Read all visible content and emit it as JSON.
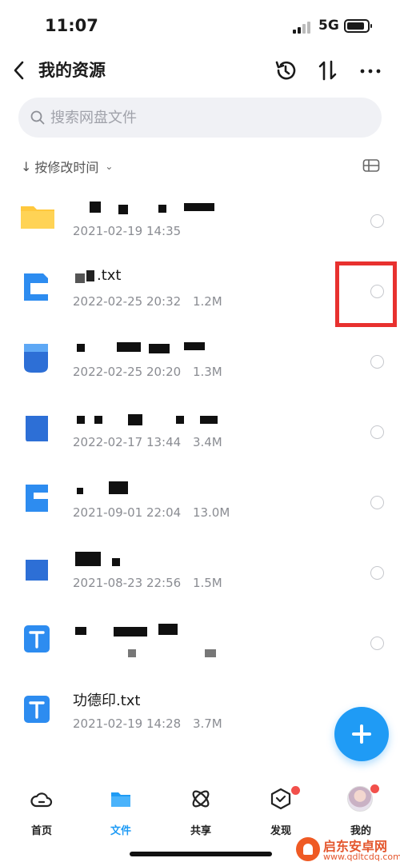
{
  "status_bar": {
    "time": "11:07",
    "network": "5G"
  },
  "header": {
    "title": "我的资源"
  },
  "search": {
    "placeholder": "搜索网盘文件"
  },
  "sort": {
    "label": "按修改时间"
  },
  "files": [
    {
      "name": "",
      "date": "2021-02-19 14:35",
      "size": "",
      "icon": "folder-icon"
    },
    {
      "name": ".txt",
      "date": "2022-02-25 20:32",
      "size": "1.2M",
      "icon": "document-icon"
    },
    {
      "name": "",
      "date": "2022-02-25 20:20",
      "size": "1.3M",
      "icon": "document-icon"
    },
    {
      "name": "",
      "date": "2022-02-17 13:44",
      "size": "3.4M",
      "icon": "document-icon"
    },
    {
      "name": "",
      "date": "2021-09-01 22:04",
      "size": "13.0M",
      "icon": "document-icon"
    },
    {
      "name": "",
      "date": "2021-08-23 22:56",
      "size": "1.5M",
      "icon": "document-icon"
    },
    {
      "name": "",
      "date": "",
      "size": "",
      "icon": "text-file-icon"
    },
    {
      "name": "功德印.txt",
      "date": "2021-02-19 14:28",
      "size": "3.7M",
      "icon": "text-file-icon"
    }
  ],
  "tabs": [
    {
      "label": "首页",
      "icon": "cloud-home-icon"
    },
    {
      "label": "文件",
      "icon": "folder-icon"
    },
    {
      "label": "共享",
      "icon": "atom-share-icon"
    },
    {
      "label": "发现",
      "icon": "discover-icon"
    },
    {
      "label": "我的",
      "icon": "avatar"
    }
  ],
  "watermark": {
    "text": "启东安卓网",
    "url": "www.qdltcdq.com"
  },
  "colors": {
    "accent": "#1f9bf5",
    "folder": "#ffc83d",
    "highlight": "#e8312f",
    "badge": "#f2504b"
  }
}
